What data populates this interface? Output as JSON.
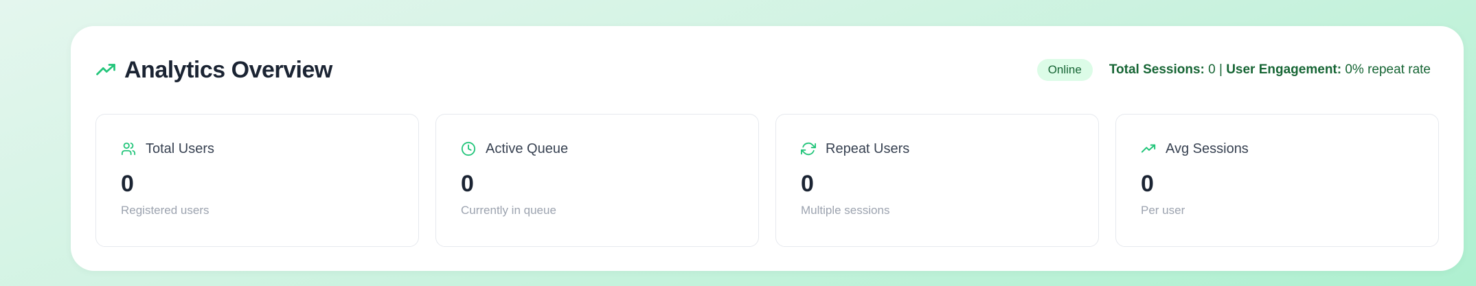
{
  "header": {
    "title": "Analytics Overview",
    "status_badge": "Online",
    "total_sessions_label": "Total Sessions:",
    "total_sessions_value": "0",
    "separator": "|",
    "engagement_label": "User Engagement:",
    "engagement_value": "0% repeat rate"
  },
  "cards": [
    {
      "icon": "users-icon",
      "label": "Total Users",
      "value": "0",
      "sub": "Registered users"
    },
    {
      "icon": "clock-icon",
      "label": "Active Queue",
      "value": "0",
      "sub": "Currently in queue"
    },
    {
      "icon": "refresh-icon",
      "label": "Repeat Users",
      "value": "0",
      "sub": "Multiple sessions"
    },
    {
      "icon": "trending-up-icon",
      "label": "Avg Sessions",
      "value": "0",
      "sub": "Per user"
    }
  ],
  "colors": {
    "accent": "#22c57a",
    "badge_bg": "#dcfce7",
    "badge_text": "#166534",
    "title": "#1b2433"
  }
}
